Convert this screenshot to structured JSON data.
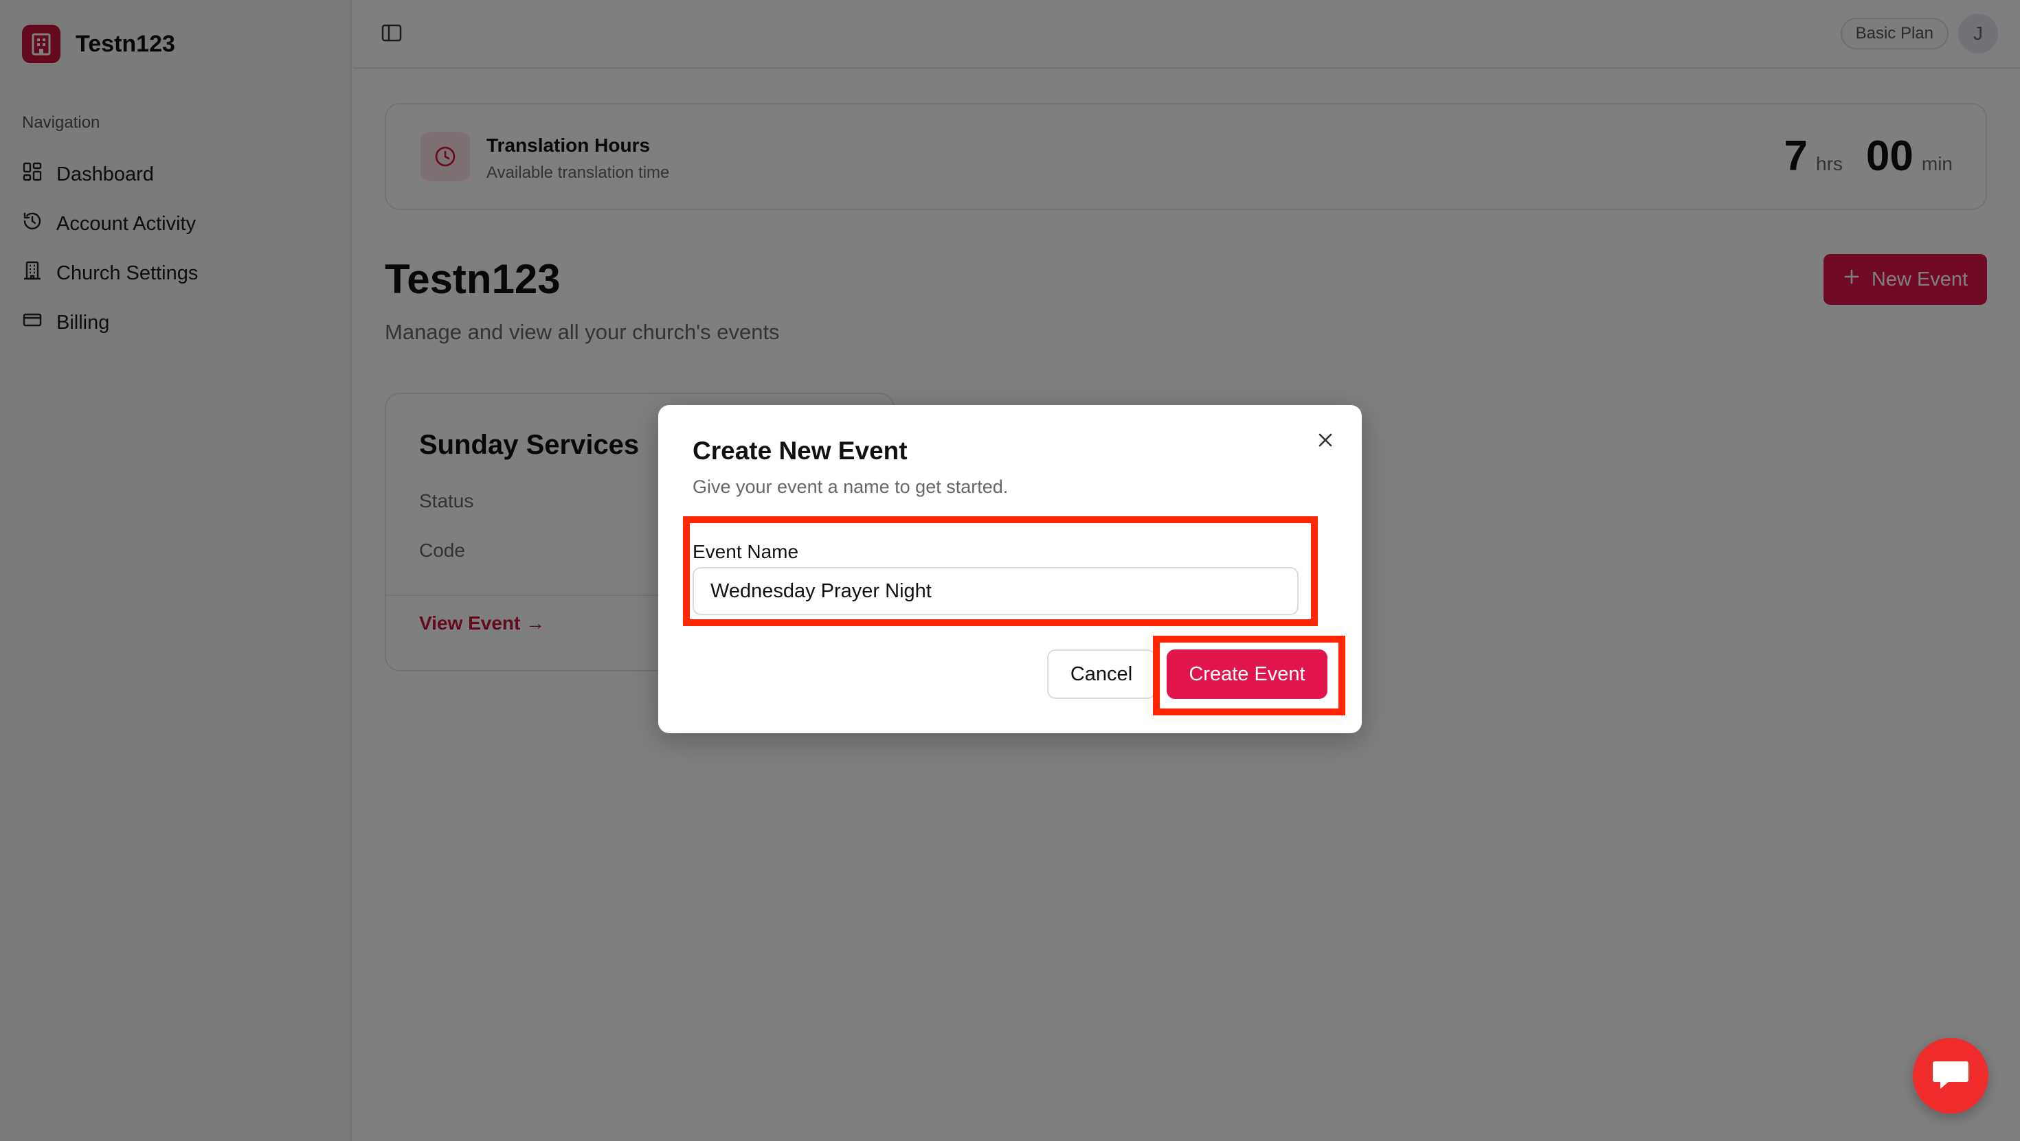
{
  "brand": {
    "name": "Testn123"
  },
  "sidebar": {
    "heading": "Navigation",
    "items": [
      {
        "label": "Dashboard",
        "icon": "dashboard-icon"
      },
      {
        "label": "Account Activity",
        "icon": "history-icon"
      },
      {
        "label": "Church Settings",
        "icon": "building-icon"
      },
      {
        "label": "Billing",
        "icon": "credit-card-icon"
      }
    ]
  },
  "topbar": {
    "plan": "Basic Plan",
    "avatar_initial": "J"
  },
  "hours": {
    "title": "Translation Hours",
    "subtitle": "Available translation time",
    "hours_value": "7",
    "hours_unit": "hrs",
    "minutes_value": "00",
    "minutes_unit": "min"
  },
  "page": {
    "title": "Testn123",
    "subtitle": "Manage and view all your church's events",
    "new_event_label": "New Event"
  },
  "event_card": {
    "title": "Sunday Services",
    "status_label": "Status",
    "code_label": "Code",
    "link_label": "View Event →"
  },
  "dialog": {
    "title": "Create New Event",
    "subtitle": "Give your event a name to get started.",
    "field_label": "Event Name",
    "field_value": "Wednesday Prayer Night",
    "cancel_label": "Cancel",
    "create_label": "Create Event"
  },
  "colors": {
    "accent": "#e0154b",
    "highlight": "#ff2600",
    "chat": "#ef2b2b"
  }
}
